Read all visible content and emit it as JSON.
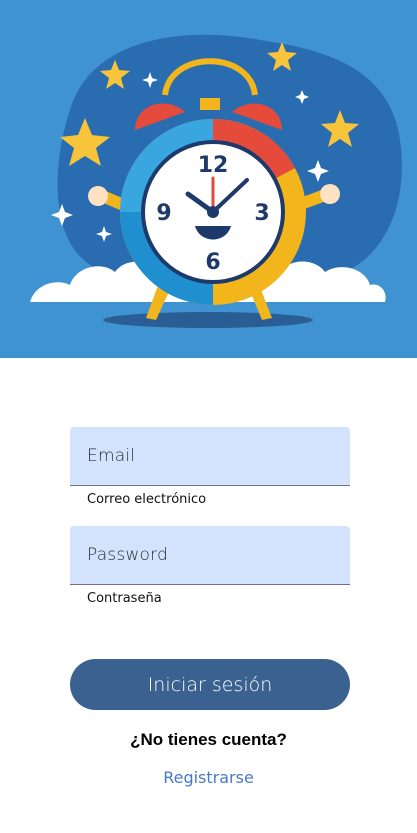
{
  "hero": {
    "image": "alarm-clock-illustration",
    "clock_numbers": [
      "12",
      "3",
      "6",
      "9"
    ]
  },
  "login": {
    "email_label": "Email",
    "email_helper": "Correo electrónico",
    "password_label": "Password",
    "password_helper": "Contraseña",
    "submit_label": "Iniciar sesión",
    "signup_question": "¿No tienes cuenta?",
    "signup_link": "Registrarse"
  },
  "colors": {
    "hero_background": "#3f93d2",
    "field_background": "#d3e3fd",
    "button_background": "#3a6190",
    "link": "#4a78c8"
  }
}
